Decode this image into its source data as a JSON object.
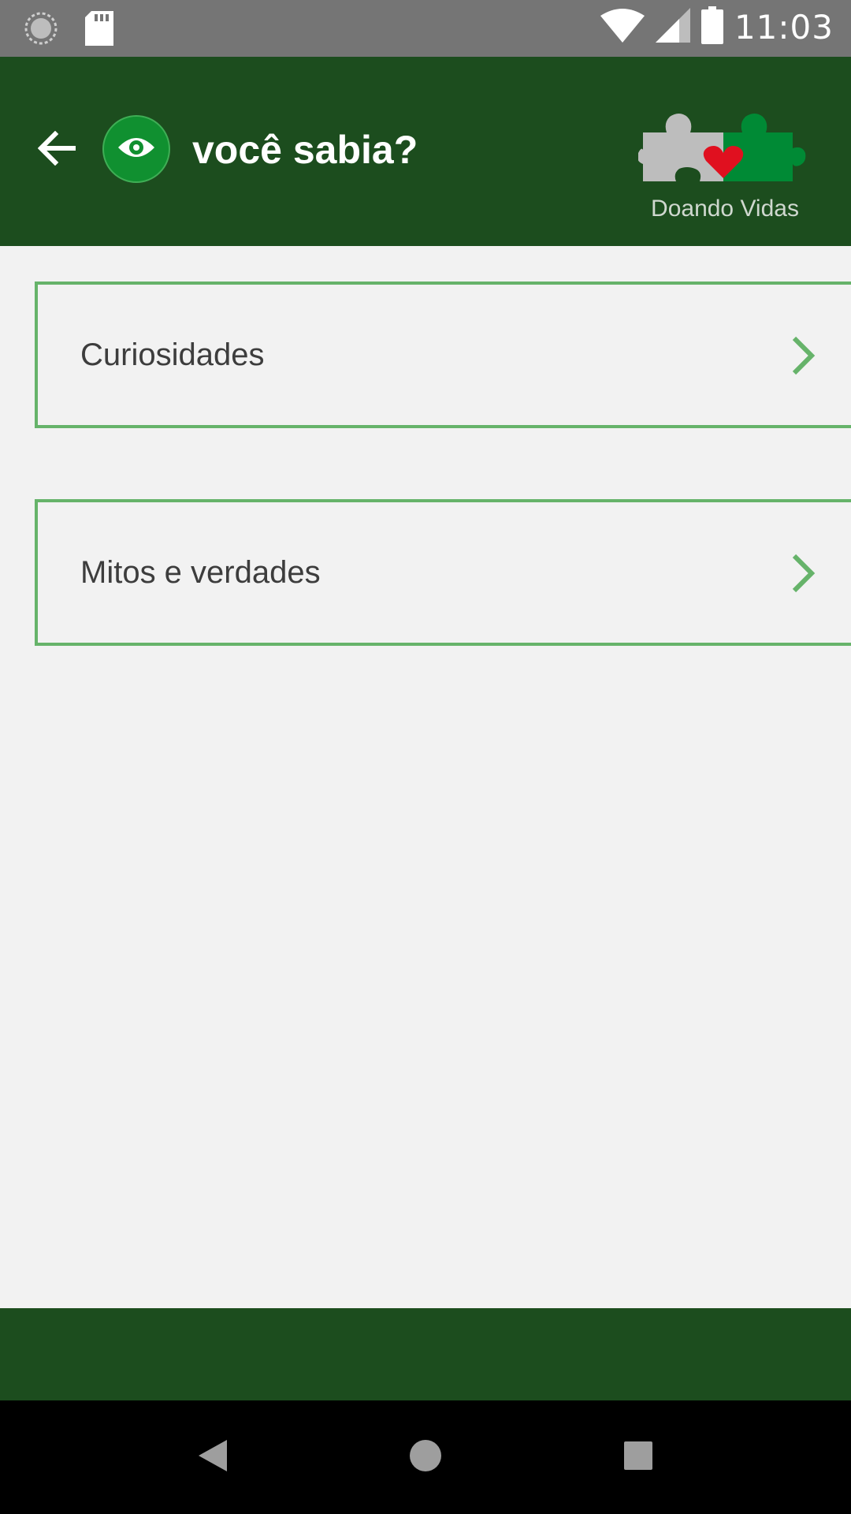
{
  "status_bar": {
    "time": "11:03",
    "icons": [
      "sync-icon",
      "sd-card-icon",
      "wifi-icon",
      "signal-icon",
      "battery-icon"
    ]
  },
  "app_bar": {
    "title": "você sabia?",
    "back_icon": "arrow-back-icon",
    "badge_icon": "eye-icon",
    "logo_text": "Doando Vidas",
    "color": "#1c4d1e"
  },
  "menu": {
    "items": [
      {
        "label": "Curiosidades"
      },
      {
        "label": "Mitos e verdades"
      }
    ],
    "border_color": "#66b36a"
  },
  "nav_bar": {
    "icons": [
      "back-triangle-icon",
      "home-circle-icon",
      "recents-square-icon"
    ]
  }
}
